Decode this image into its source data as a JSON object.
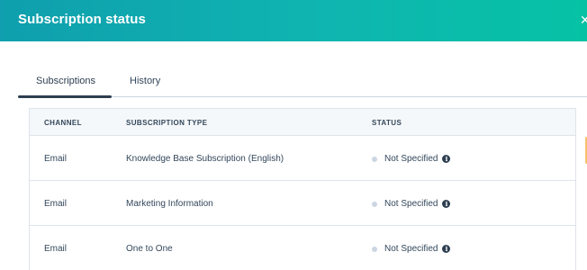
{
  "header": {
    "title": "Subscription status"
  },
  "tabs": [
    {
      "label": "Subscriptions",
      "active": true
    },
    {
      "label": "History",
      "active": false
    }
  ],
  "table": {
    "columns": [
      "CHANNEL",
      "SUBSCRIPTION TYPE",
      "STATUS"
    ],
    "rows": [
      {
        "channel": "Email",
        "type": "Knowledge Base Subscription (English)",
        "status": "Not Specified"
      },
      {
        "channel": "Email",
        "type": "Marketing Information",
        "status": "Not Specified"
      },
      {
        "channel": "Email",
        "type": "One to One",
        "status": "Not Specified"
      }
    ]
  },
  "colors": {
    "header_start": "#0f9fae",
    "header_end": "#06c2a5",
    "status_dot": "#cbd6e2",
    "text": "#33475b"
  },
  "icons": {
    "close": "close-icon",
    "info": "info-icon"
  }
}
